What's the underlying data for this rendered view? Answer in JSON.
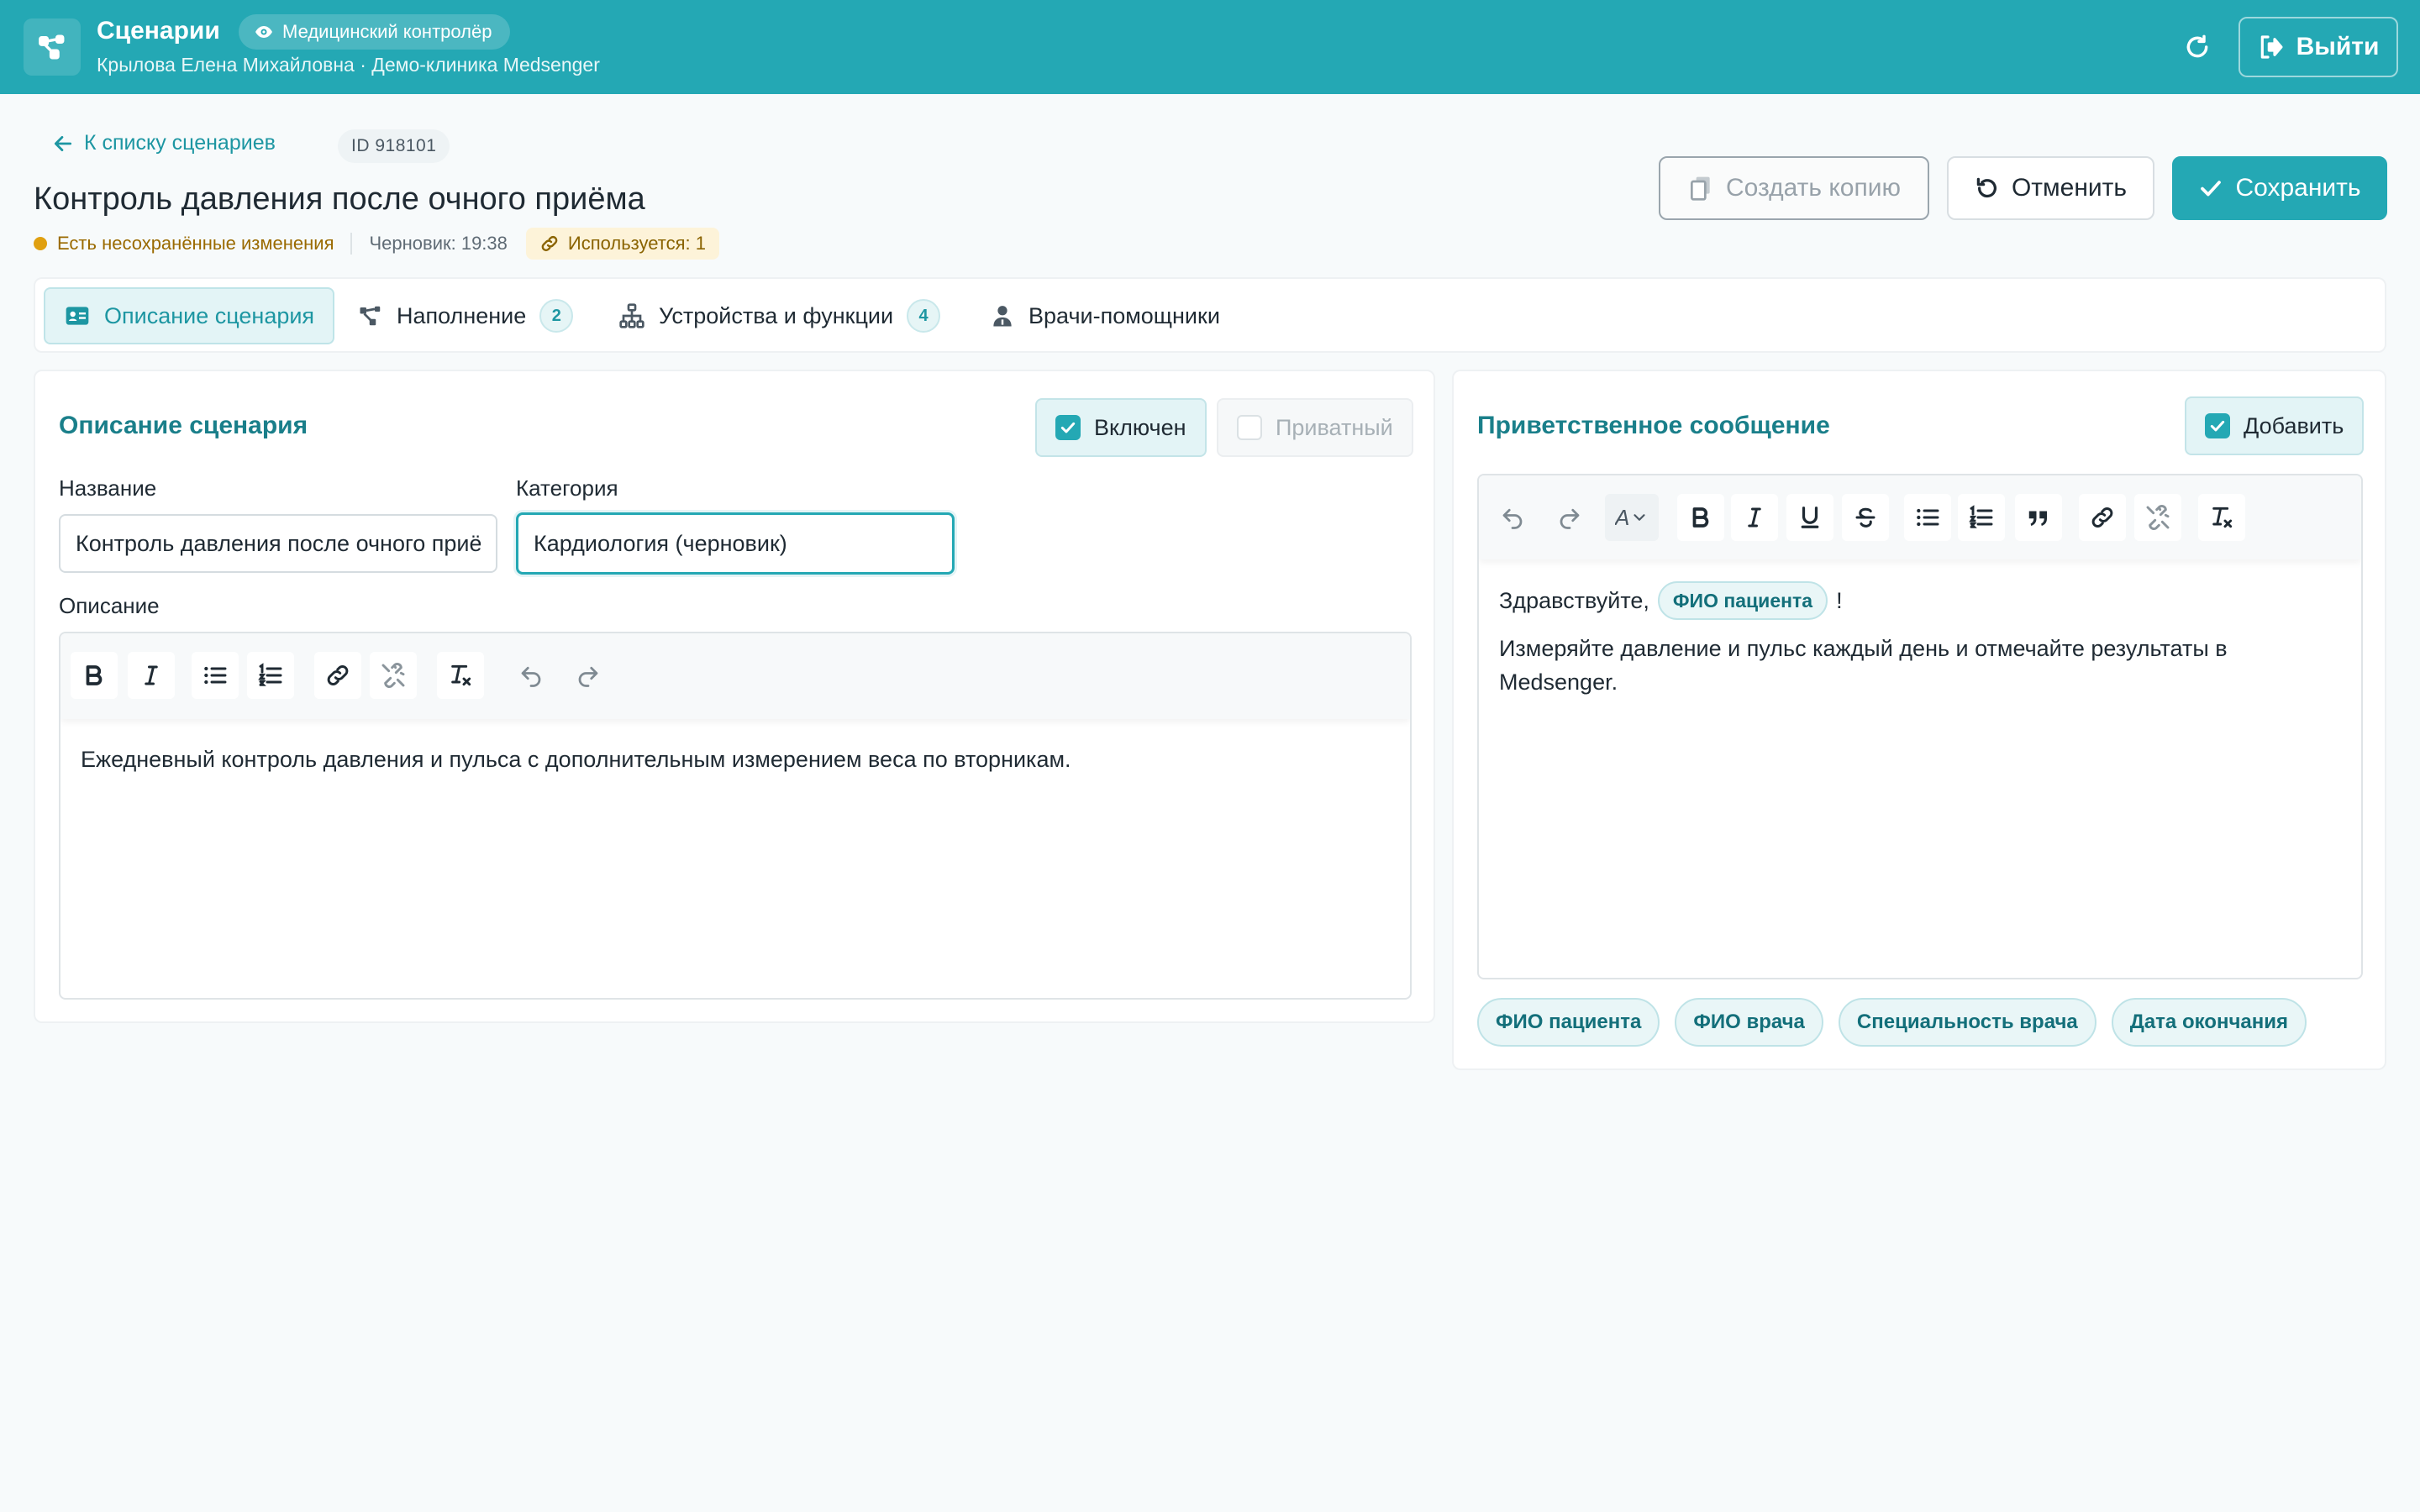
{
  "header": {
    "app_title": "Сценарии",
    "role_badge": "Медицинский контролёр",
    "user_line": "Крылова Елена Михайловна · Демо-клиника Medsenger",
    "logout_label": "Выйти"
  },
  "page": {
    "back_link": "К списку сценариев",
    "id_label": "ID 918101",
    "title": "Контроль давления после очного приёма",
    "unsaved_label": "Есть несохранённые изменения",
    "draft_label": "Черновик: 19:38",
    "usage_label": "Используется: 1",
    "actions": {
      "copy": "Создать копию",
      "cancel": "Отменить",
      "save": "Сохранить"
    }
  },
  "tabs": [
    {
      "label": "Описание сценария",
      "active": true
    },
    {
      "label": "Наполнение",
      "count": "2"
    },
    {
      "label": "Устройства и функции",
      "count": "4"
    },
    {
      "label": "Врачи-помощники"
    }
  ],
  "description_card": {
    "title": "Описание сценария",
    "enabled_label": "Включен",
    "enabled": true,
    "private_label": "Приватный",
    "private": false,
    "name_label": "Название",
    "name_value": "Контроль давления после очного приёма",
    "category_label": "Категория",
    "category_value": "Кардиология (черновик)",
    "description_label": "Описание",
    "description_text": "Ежедневный контроль давления и пульса с дополнительным измерением веса по вторникам."
  },
  "welcome_card": {
    "title": "Приветственное сообщение",
    "add_label": "Добавить",
    "add_checked": true,
    "font_size_label": "A",
    "greeting": "Здравствуйте,",
    "greeting_var": "ФИО пациента",
    "greeting_end": "!",
    "body_text": "Измеряйте давление и пульс каждый день и отмечайте результаты в Medsenger.",
    "variables": [
      "ФИО пациента",
      "ФИО врача",
      "Специальность врача",
      "Дата окончания"
    ]
  },
  "colors": {
    "accent": "#24a8b4",
    "accent_dark": "#1a7f8a",
    "warning": "#e0a010"
  }
}
